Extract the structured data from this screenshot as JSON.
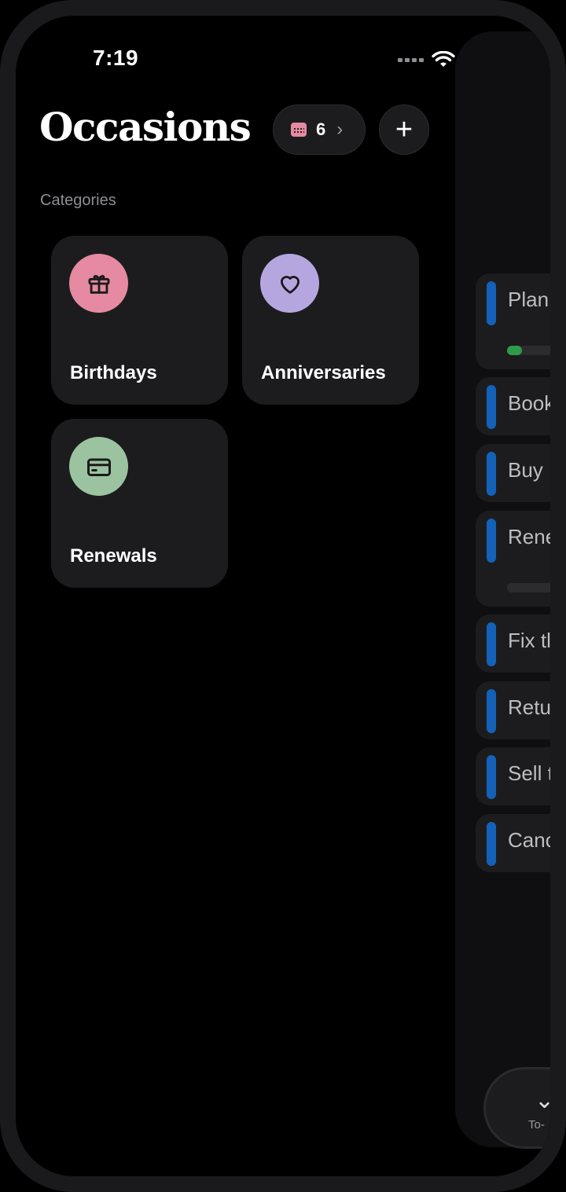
{
  "status_bar": {
    "time": "7:19"
  },
  "header": {
    "title": "Occasions",
    "count": "6",
    "add_symbol": "+"
  },
  "section_label": "Categories",
  "categories": [
    {
      "label": "Birthdays",
      "icon": "gift-icon",
      "color": "#e58aa2"
    },
    {
      "label": "Anniversaries",
      "icon": "heart-icon",
      "color": "#b6a6e0"
    },
    {
      "label": "Renewals",
      "icon": "credit-card-icon",
      "color": "#9cc3a0"
    }
  ],
  "tasks": [
    {
      "text": "Plan",
      "progress": 0.1
    },
    {
      "text": "Book"
    },
    {
      "text": "Buy"
    },
    {
      "text": "Rene",
      "progress": 0
    },
    {
      "text": "Fix tl"
    },
    {
      "text": "Retu"
    },
    {
      "text": "Sell t"
    },
    {
      "text": "Canc"
    }
  ],
  "bottom_tab": {
    "label": "To-"
  },
  "colors": {
    "accent_blue": "#1362b8",
    "progress_green": "#2f9a4a"
  }
}
